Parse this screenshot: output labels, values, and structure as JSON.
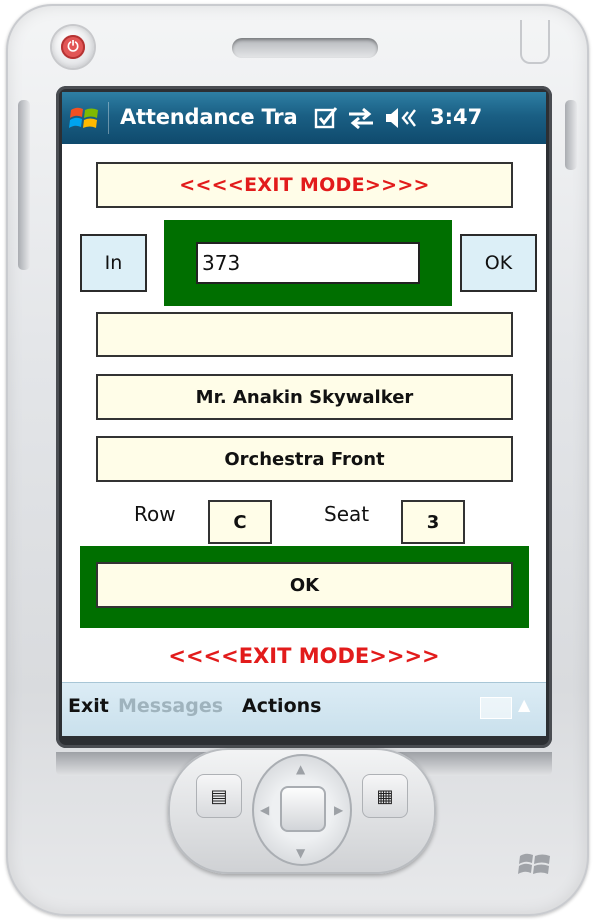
{
  "titlebar": {
    "app_title": "Attendance Tra",
    "time": "3:47",
    "icons": [
      "windows-start-icon",
      "checkbox-icon",
      "connectivity-icon",
      "volume-icon"
    ]
  },
  "form": {
    "mode_banner_top": "<<<<EXIT MODE>>>>",
    "in_button": "In",
    "id_input_value": "373",
    "ok_small_button": "OK",
    "blank_field": "",
    "name_field": "Mr. Anakin Skywalker",
    "section_field": "Orchestra Front",
    "row_label": "Row",
    "row_value": "C",
    "seat_label": "Seat",
    "seat_value": "3",
    "ok_big_button": "OK",
    "mode_banner_bottom": "<<<<EXIT MODE>>>>"
  },
  "menubar": {
    "exit": "Exit",
    "messages": "Messages",
    "actions": "Actions"
  },
  "colors": {
    "title_bar": "#1a5f84",
    "exit_text": "#e21b1b",
    "green_frame": "#006f00",
    "field_bg": "#fffde8",
    "button_bg": "#dceff7",
    "menubar_bg": "#dcecf5",
    "messages_disabled": "#9fb3bd"
  },
  "hardware": {
    "icons": [
      "power-icon",
      "contacts-key-icon",
      "calendar-key-icon",
      "dpad-icon",
      "windows-badge-icon"
    ]
  }
}
